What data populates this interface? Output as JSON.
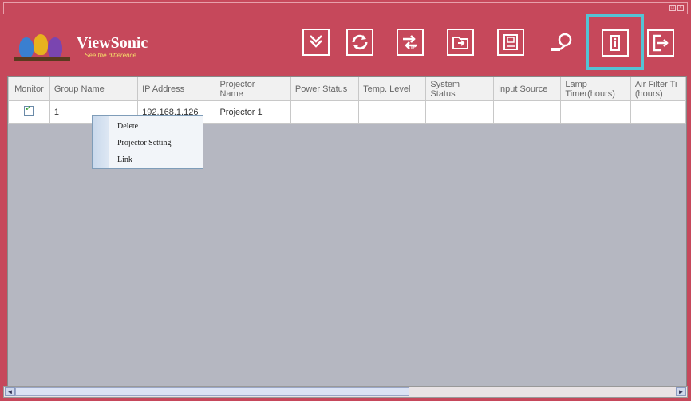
{
  "window": {
    "controls": [
      "□",
      "×"
    ]
  },
  "brand": {
    "name": "ViewSonic",
    "tagline": "See the difference"
  },
  "toolbar": {
    "buttons": [
      {
        "icon": "download-icon"
      },
      {
        "icon": "refresh-icon"
      },
      {
        "icon": "ip-change-icon"
      },
      {
        "icon": "import-icon"
      },
      {
        "icon": "save-icon"
      },
      {
        "icon": "tool-icon"
      },
      {
        "icon": "info-icon"
      },
      {
        "icon": "exit-icon"
      }
    ],
    "highlight_color": "#54c3d4"
  },
  "table": {
    "headers": [
      "Monitor",
      "Group Name",
      "IP Address",
      "Projector Name",
      "Power Status",
      "Temp. Level",
      "System Status",
      "Input Source",
      "Lamp Timer(hours)",
      "Air Filter Timer(hours)"
    ],
    "header_display": [
      "Monitor",
      "Group Name",
      "IP Address",
      "Projector\nName",
      "Power Status",
      "Temp. Level",
      "System\nStatus",
      "Input Source",
      "Lamp\nTimer(hours)",
      "Air Filter Ti\n(hours)"
    ],
    "rows": [
      {
        "monitor_checked": true,
        "group": "1",
        "ip": "192.168.1.126",
        "name": "Projector 1",
        "power": "",
        "temp": "",
        "system": "",
        "input": "",
        "lamp": "",
        "filter": ""
      }
    ]
  },
  "context_menu": {
    "items": [
      "Delete",
      "Projector Setting",
      "Link"
    ]
  },
  "colors": {
    "frame": "#c6485b",
    "grid_bg": "#b5b7c1"
  }
}
